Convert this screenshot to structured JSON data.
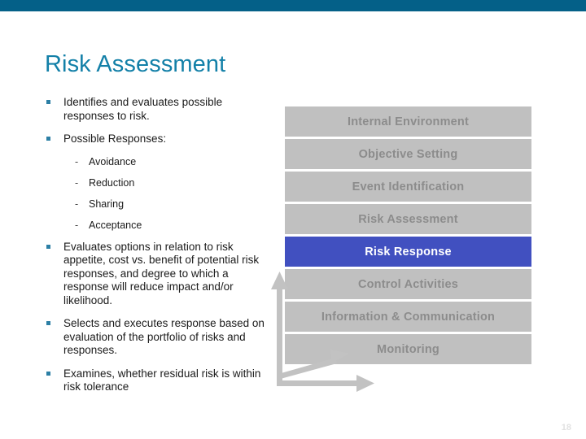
{
  "slide": {
    "title": "Risk Assessment",
    "page_number": "18",
    "accent_bar_color": "#046088",
    "title_color": "#1380a8",
    "bullet_marker_color": "#2c7fa5",
    "bar_color": "#c0c0c0",
    "bar_text_color": "#8c8c8c",
    "highlight_color": "#4150c0",
    "highlight_text_color": "#ffffff",
    "arrow_color": "#c2c2c2"
  },
  "bullets": [
    {
      "text": "Identifies and evaluates possible responses to risk."
    },
    {
      "text": "Possible Responses:"
    },
    {
      "text": "Evaluates options in relation to risk appetite, cost vs. benefit of potential risk responses, and degree to which a response will reduce impact and/or likelihood."
    },
    {
      "text": "Selects and executes response based on evaluation of the portfolio of risks and responses."
    },
    {
      "text": "Examines, whether residual risk is within risk tolerance"
    }
  ],
  "sub_bullets": [
    {
      "marker": "-",
      "text": "Avoidance"
    },
    {
      "marker": "-",
      "text": "Reduction"
    },
    {
      "marker": "-",
      "text": "Sharing"
    },
    {
      "marker": "-",
      "text": "Acceptance"
    }
  ],
  "framework_bars": [
    {
      "label": "Internal Environment",
      "highlighted": false
    },
    {
      "label": "Objective Setting",
      "highlighted": false
    },
    {
      "label": "Event Identification",
      "highlighted": false
    },
    {
      "label": "Risk Assessment",
      "highlighted": false
    },
    {
      "label": "Risk Response",
      "highlighted": true
    },
    {
      "label": "Control Activities",
      "highlighted": false
    },
    {
      "label": "Information & Communication",
      "highlighted": false
    },
    {
      "label": "Monitoring",
      "highlighted": false
    }
  ]
}
